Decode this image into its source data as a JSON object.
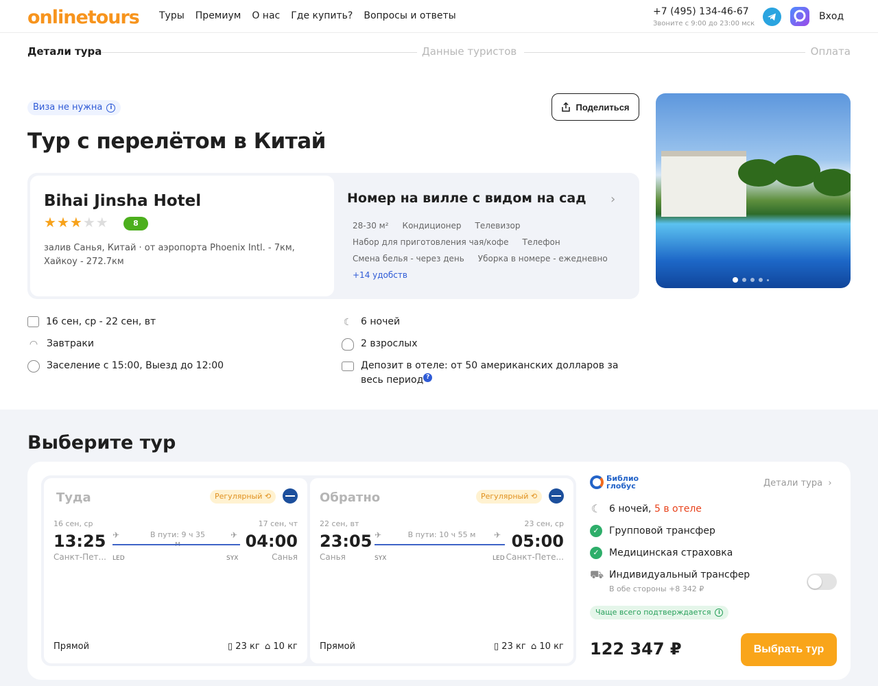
{
  "header": {
    "logo": "onlinetours",
    "nav": [
      "Туры",
      "Премиум",
      "О нас",
      "Где купить?",
      "Вопросы и ответы"
    ],
    "phone": "+7 (495) 134-46-67",
    "phone_note": "Звоните с 9:00 до 23:00 мск",
    "login": "Вход"
  },
  "steps": [
    "Детали тура",
    "Данные туристов",
    "Оплата"
  ],
  "tour": {
    "visa_badge": "Виза не нужна",
    "share_label": "Поделиться",
    "title": "Тур с перелётом в Китай"
  },
  "hotel": {
    "name": "Bihai Jinsha Hotel",
    "stars": 3,
    "rating": "8",
    "location": "залив Санья, Китай · от аэропорта Phoenix Intl. - 7км, Хайкоу - 272.7км",
    "room_title": "Номер на вилле с видом на сад",
    "amenities": [
      [
        "28-30 м²",
        "Кондиционер",
        "Телевизор"
      ],
      [
        "Набор для приготовления чая/кофе",
        "Телефон"
      ],
      [
        "Смена белья - через день",
        "Уборка в номере - ежедневно"
      ]
    ],
    "more_amenities": "+14 удобств",
    "photo_count_dots": 5
  },
  "facts": {
    "dates": "16 сен, ср - 22 сен, вт",
    "nights": "6 ночей",
    "meal": "Завтраки",
    "tourists": "2 взрослых",
    "checkin": "Заселение с 15:00, Выезд до 12:00",
    "deposit": "Депозит в отеле: от 50 американских долларов за весь период",
    "deposit_help": "?"
  },
  "choose": {
    "title": "Выберите тур",
    "flights": [
      {
        "title": "Туда",
        "type": "Регулярный",
        "dep_date": "16 сен, ср",
        "dep_time": "13:25",
        "dep_city": "Санкт-Пет...",
        "dep_code": "LED",
        "duration": "В пути: 9 ч 35 м",
        "arr_date": "17 сен, чт",
        "arr_time": "04:00",
        "arr_city": "Санья",
        "arr_code": "SYX",
        "direct": "Прямой",
        "baggage": "23 кг",
        "handbag": "10 кг"
      },
      {
        "title": "Обратно",
        "type": "Регулярный",
        "dep_date": "22 сен, вт",
        "dep_time": "23:05",
        "dep_city": "Санья",
        "dep_code": "SYX",
        "duration": "В пути: 10 ч 55 м",
        "arr_date": "23 сен, ср",
        "arr_time": "05:00",
        "arr_city": "Санкт-Пете...",
        "arr_code": "LED",
        "direct": "Прямой",
        "baggage": "23 кг",
        "handbag": "10 кг"
      }
    ],
    "operator": {
      "name_line1": "Библио",
      "name_line2": "глобус",
      "details": "Детали тура",
      "nights": "6 ночей,",
      "nights_hotel": "5 в отеле",
      "transfer": "Групповой трансфер",
      "insurance": "Медицинская страховка",
      "ind_transfer": "Индивидуальный трансфер",
      "ind_transfer_note": "В обе стороны +8 342 ₽",
      "confirm": "Чаще всего подтверждается",
      "price": "122 347 ₽",
      "book": "Выбрать тур"
    }
  },
  "colors": {
    "accent": "#f9a51a",
    "brand": "#f7941d",
    "link": "#2f5bd6",
    "success": "#2eae6a",
    "rating": "#4caf1d"
  }
}
